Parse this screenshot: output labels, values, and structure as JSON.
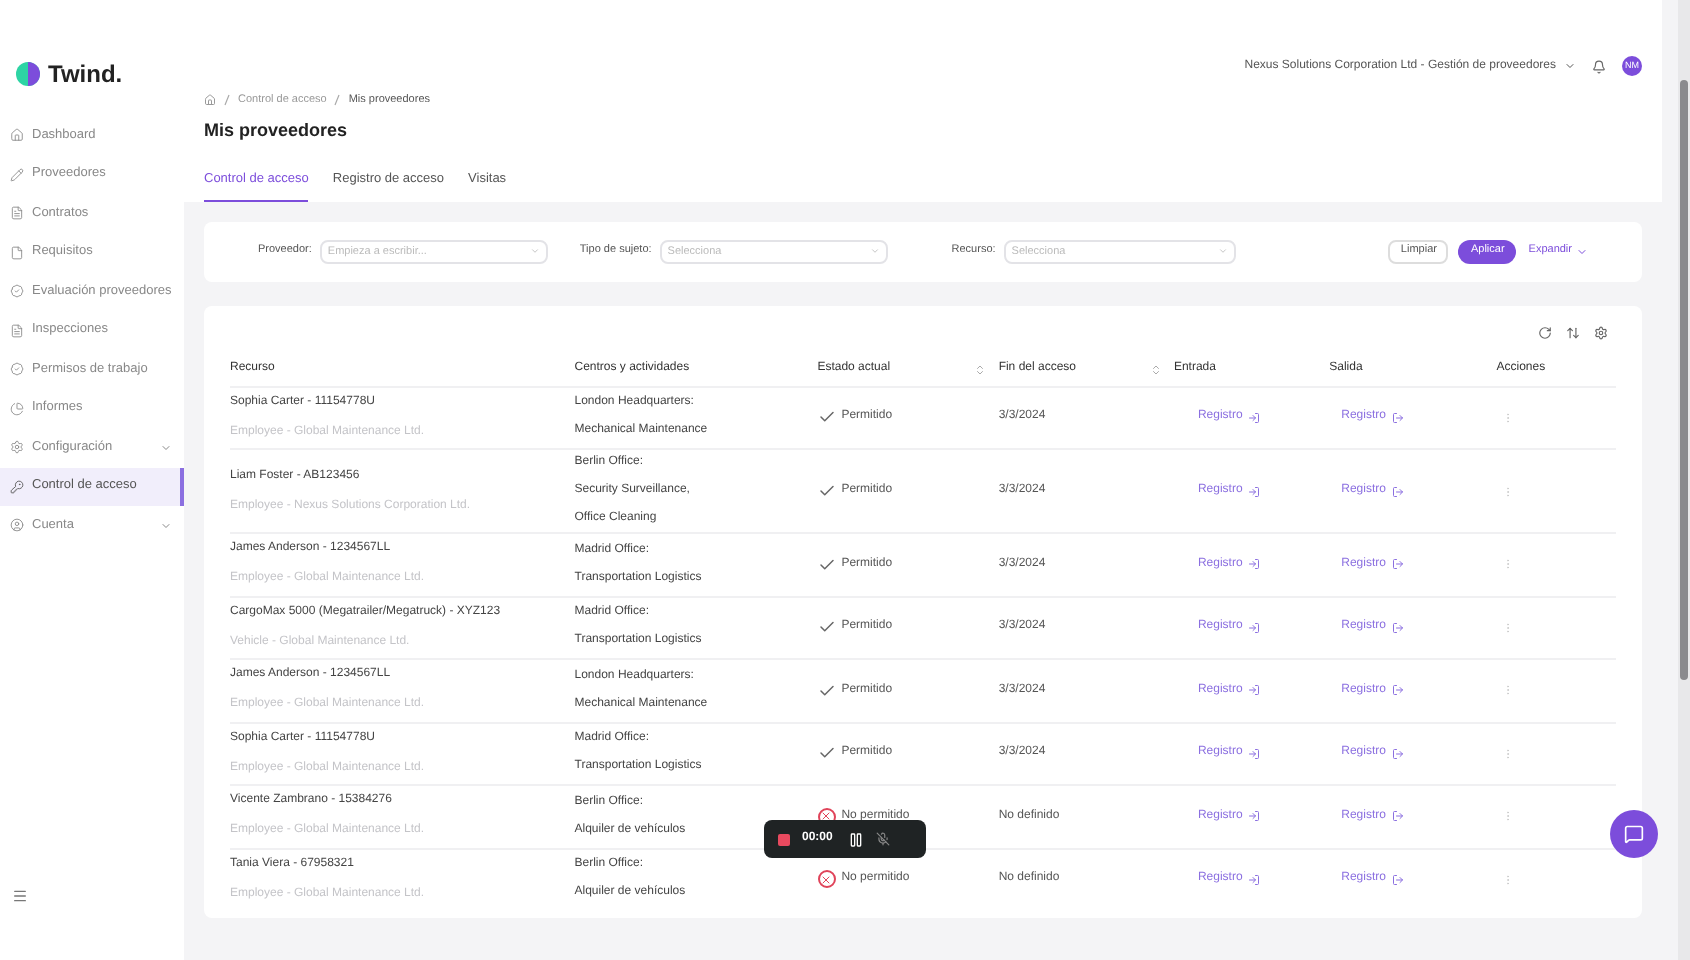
{
  "brand": "Twind.",
  "sidebar": [
    {
      "label": "Dashboard",
      "selected": false,
      "expandable": false
    },
    {
      "label": "Proveedores",
      "selected": false,
      "expandable": false
    },
    {
      "label": "Contratos",
      "selected": false,
      "expandable": false
    },
    {
      "label": "Requisitos",
      "selected": false,
      "expandable": false
    },
    {
      "label": "Evaluación proveedores",
      "selected": false,
      "expandable": false
    },
    {
      "label": "Inspecciones",
      "selected": false,
      "expandable": false
    },
    {
      "label": "Permisos de trabajo",
      "selected": false,
      "expandable": false
    },
    {
      "label": "Informes",
      "selected": false,
      "expandable": false
    },
    {
      "label": "Configuración",
      "selected": false,
      "expandable": true
    },
    {
      "label": "Control de acceso",
      "selected": true,
      "expandable": false
    },
    {
      "label": "Cuenta",
      "selected": false,
      "expandable": true
    }
  ],
  "header": {
    "company": "Nexus Solutions Corporation Ltd - Gestión de proveedores",
    "avatar": "NM"
  },
  "breadcrumb": [
    "Control de acceso",
    "Mis proveedores"
  ],
  "title": "Mis proveedores",
  "tabs": [
    {
      "label": "Control de acceso",
      "selected": true
    },
    {
      "label": "Registro de acceso",
      "selected": false
    },
    {
      "label": "Visitas",
      "selected": false
    }
  ],
  "filters": [
    {
      "label": "Proveedor:",
      "placeholder": "Empieza a escribir..."
    },
    {
      "label": "Tipo de sujeto:",
      "placeholder": "Selecciona"
    },
    {
      "label": "Recurso:",
      "placeholder": "Selecciona"
    }
  ],
  "filter_buttons": {
    "clear": "Limpiar",
    "apply": "Aplicar",
    "expand": "Expandir"
  },
  "table": {
    "columns": [
      {
        "label": "Recurso",
        "sortable": false
      },
      {
        "label": "Centros y actividades",
        "sortable": false
      },
      {
        "label": "Estado actual",
        "sortable": true
      },
      {
        "label": "Fin del acceso",
        "sortable": true
      },
      {
        "label": "Entrada",
        "sortable": false
      },
      {
        "label": "Salida",
        "sortable": false
      },
      {
        "label": "Acciones",
        "sortable": false
      }
    ],
    "rows": [
      {
        "name": "Sophia Carter - 11154778U",
        "sub": "Employee - Global Maintenance Ltd.",
        "centers": [
          "London Headquarters:",
          "Mechanical Maintenance"
        ],
        "status": {
          "kind": "allowed",
          "label": "Permitido"
        },
        "end": "3/3/2024",
        "entry": "Registro",
        "exit": "Registro"
      },
      {
        "name": "Liam Foster - AB123456",
        "sub": "Employee - Nexus Solutions Corporation Ltd.",
        "centers": [
          "Berlin Office:",
          "Security Surveillance,",
          "Office Cleaning"
        ],
        "status": {
          "kind": "allowed",
          "label": "Permitido"
        },
        "end": "3/3/2024",
        "entry": "Registro",
        "exit": "Registro"
      },
      {
        "name": "James Anderson - 1234567LL",
        "sub": "Employee - Global Maintenance Ltd.",
        "centers": [
          "Madrid Office:",
          "Transportation Logistics"
        ],
        "status": {
          "kind": "allowed",
          "label": "Permitido"
        },
        "end": "3/3/2024",
        "entry": "Registro",
        "exit": "Registro"
      },
      {
        "name": "CargoMax 5000 (Megatrailer/Megatruck) - XYZ123",
        "sub": "Vehicle - Global Maintenance Ltd.",
        "centers": [
          "Madrid Office:",
          "Transportation Logistics"
        ],
        "status": {
          "kind": "allowed",
          "label": "Permitido"
        },
        "end": "3/3/2024",
        "entry": "Registro",
        "exit": "Registro"
      },
      {
        "name": "James Anderson - 1234567LL",
        "sub": "Employee - Global Maintenance Ltd.",
        "centers": [
          "London Headquarters:",
          "Mechanical Maintenance"
        ],
        "status": {
          "kind": "allowed",
          "label": "Permitido"
        },
        "end": "3/3/2024",
        "entry": "Registro",
        "exit": "Registro"
      },
      {
        "name": "Sophia Carter - 11154778U",
        "sub": "Employee - Global Maintenance Ltd.",
        "centers": [
          "Madrid Office:",
          "Transportation Logistics"
        ],
        "status": {
          "kind": "allowed",
          "label": "Permitido"
        },
        "end": "3/3/2024",
        "entry": "Registro",
        "exit": "Registro"
      },
      {
        "name": "Vicente Zambrano - 15384276",
        "sub": "Employee - Global Maintenance Ltd.",
        "centers": [
          "Berlin Office:",
          "Alquiler de vehículos"
        ],
        "status": {
          "kind": "denied",
          "label": "No permitido"
        },
        "end": "No definido",
        "entry": "Registro",
        "exit": "Registro"
      },
      {
        "name": "Tania Viera - 67958321",
        "sub": "Employee - Global Maintenance Ltd.",
        "centers": [
          "Berlin Office:",
          "Alquiler de vehículos"
        ],
        "status": {
          "kind": "denied",
          "label": "No permitido"
        },
        "end": "No definido",
        "entry": "Registro",
        "exit": "Registro"
      }
    ]
  },
  "recorder": {
    "time": "00:00"
  }
}
